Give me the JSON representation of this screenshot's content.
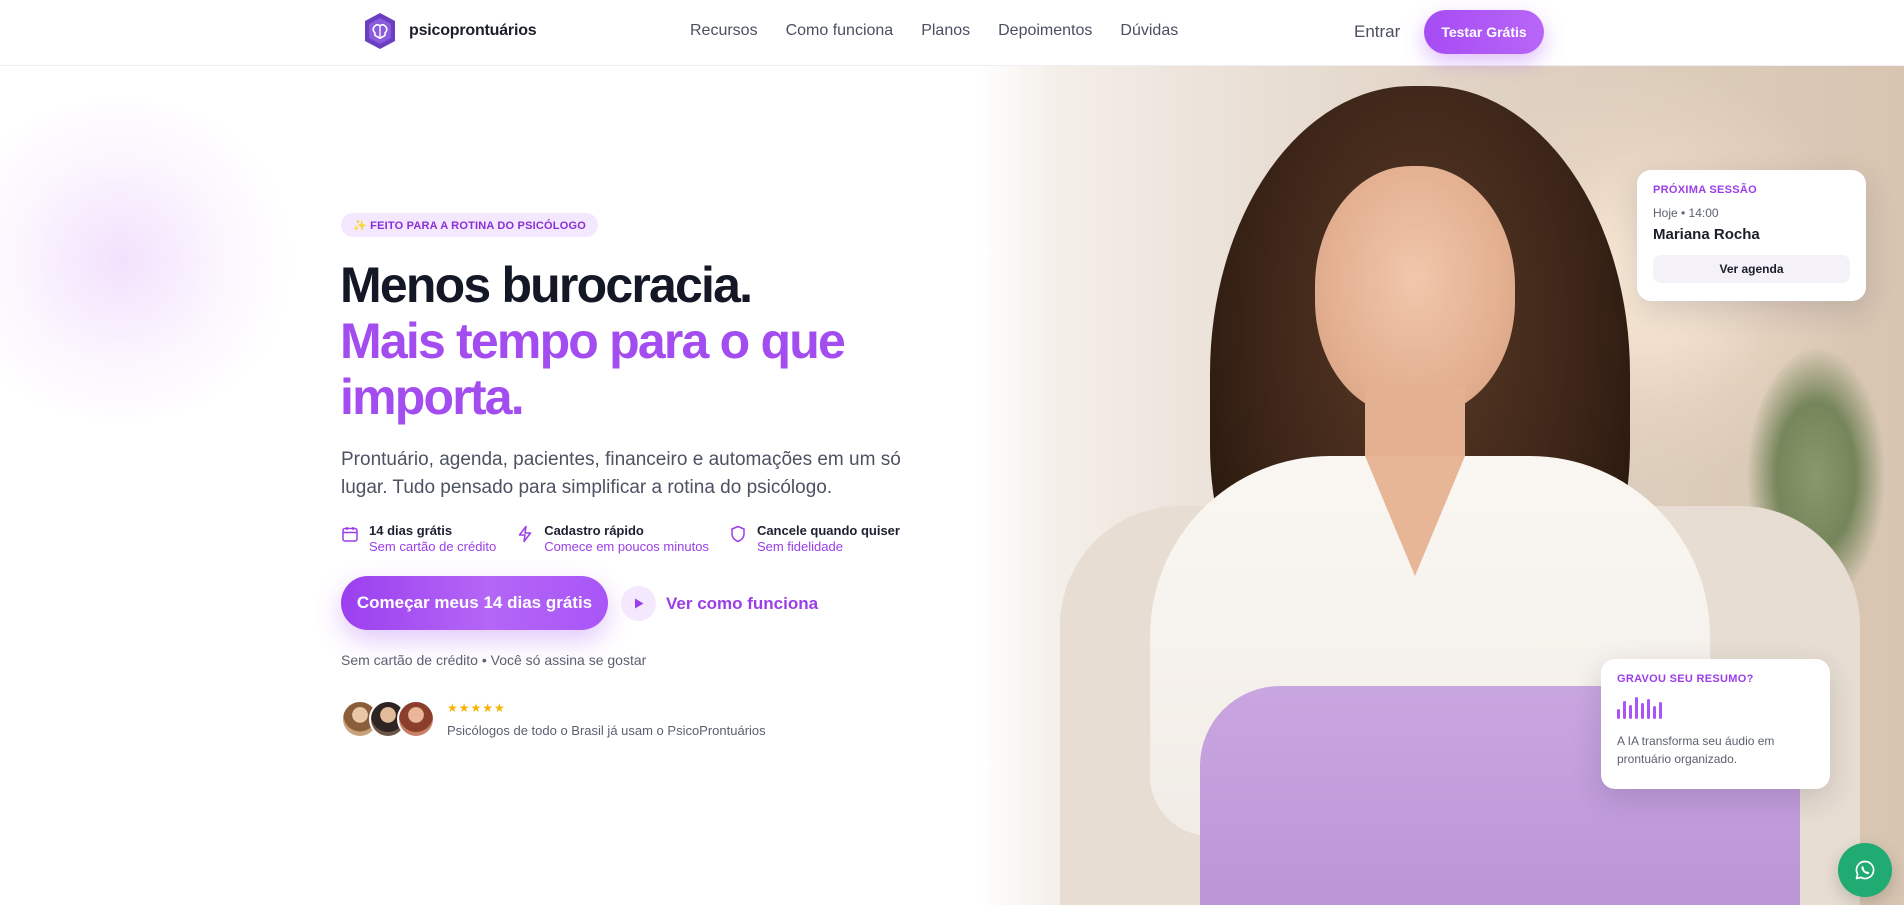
{
  "brand": {
    "name": "psicoprontuários",
    "accent": "#a34cf0"
  },
  "nav": {
    "items": [
      "Recursos",
      "Como funciona",
      "Planos",
      "Depoimentos",
      "Dúvidas"
    ]
  },
  "header": {
    "login_label": "Entrar",
    "cta_label": "Testar Grátis"
  },
  "hero": {
    "badge": "✨ FEITO PARA A ROTINA DO PSICÓLOGO",
    "title_line1": "Menos burocracia.",
    "title_line2": "Mais tempo para o que importa.",
    "lead": "Prontuário, agenda, pacientes, financeiro e automações em um só lugar. Tudo pensado para simplificar a rotina do psicólogo.",
    "features": [
      {
        "icon": "calendar-icon",
        "title": "14 dias grátis",
        "subtitle": "Sem cartão de crédito"
      },
      {
        "icon": "lightning-icon",
        "title": "Cadastro rápido",
        "subtitle": "Comece em poucos minutos"
      },
      {
        "icon": "shield-icon",
        "title": "Cancele quando quiser",
        "subtitle": "Sem fidelidade"
      }
    ],
    "primary_cta": "Começar meus 14 dias grátis",
    "secondary_cta": "Ver como funciona",
    "fineprint": "Sem cartão de crédito • Você só assina se gostar",
    "social_proof": {
      "stars": "★★★★★",
      "rating": 5,
      "text": "Psicólogos de todo o Brasil já usam o PsicoProntuários"
    }
  },
  "session_card": {
    "kicker": "PRÓXIMA SESSÃO",
    "when": "Hoje • 14:00",
    "patient": "Mariana Rocha",
    "button": "Ver agenda"
  },
  "ai_card": {
    "kicker": "GRAVOU SEU RESUMO?",
    "description": "A IA transforma seu áudio em prontuário organizado."
  },
  "floating": {
    "whatsapp_icon": "whatsapp-icon"
  }
}
